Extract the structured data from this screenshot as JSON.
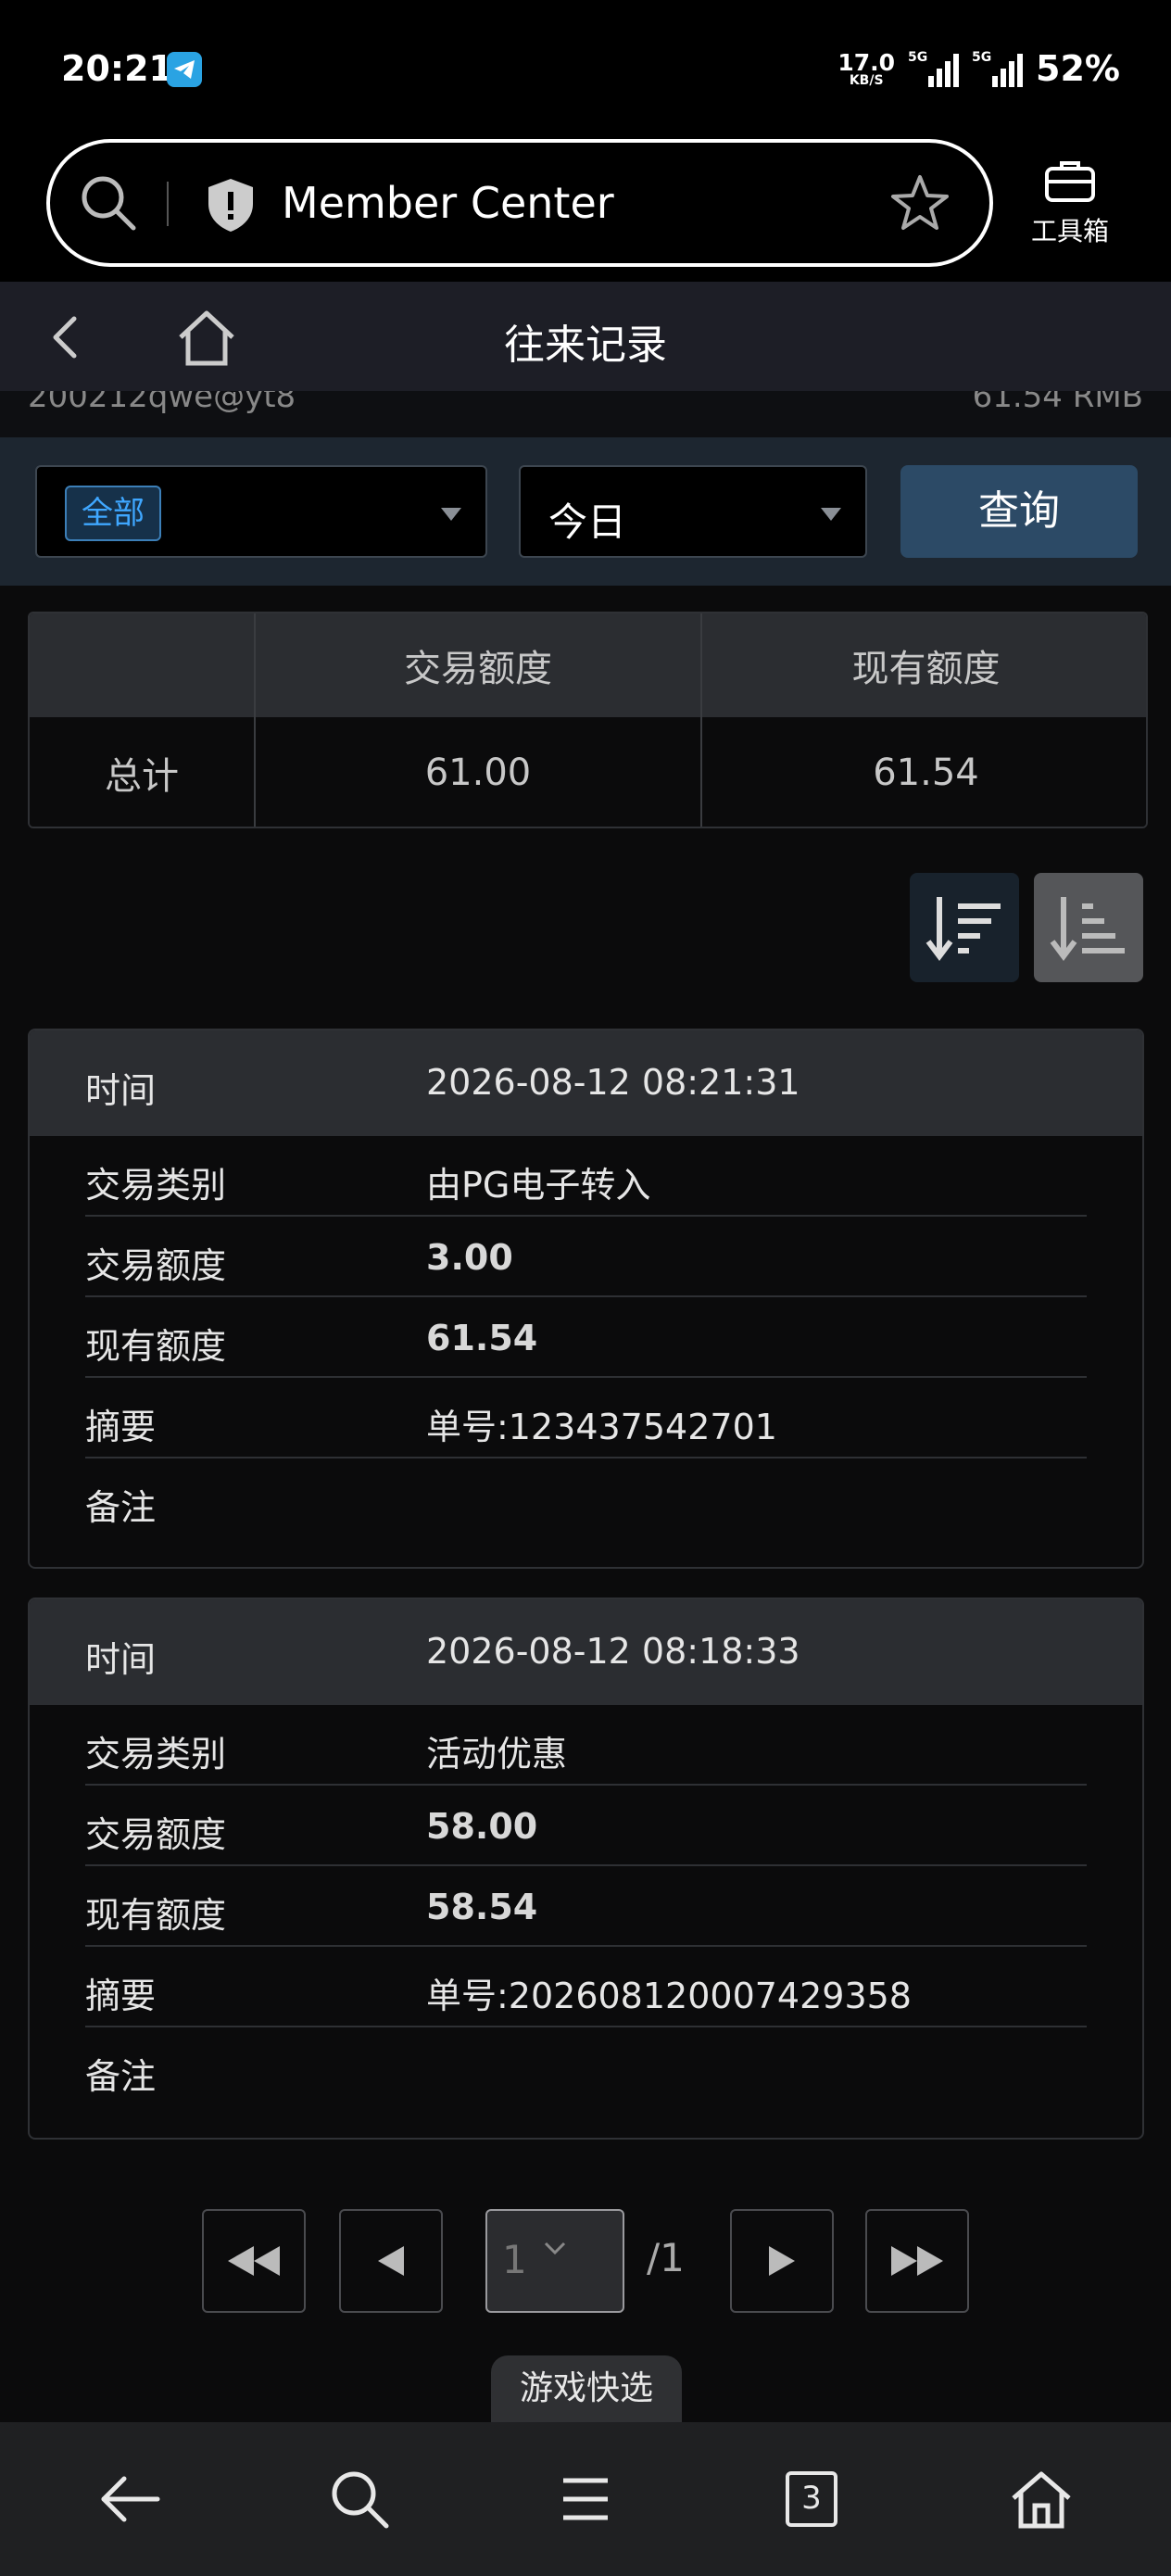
{
  "status_bar": {
    "time": "20:21",
    "net_speed_value": "17.0",
    "net_speed_unit": "KB/S",
    "signal_1_label": "5G",
    "signal_2_label": "5G",
    "battery": "52%"
  },
  "browser": {
    "address_title": "Member Center",
    "toolbox_label": "工具箱"
  },
  "header": {
    "title": "往来记录"
  },
  "account": {
    "username": "200212qwe@yt8",
    "balance": "61.54 RMB"
  },
  "filter": {
    "type_selected": "全部",
    "period_selected": "今日",
    "query_label": "查询"
  },
  "summary": {
    "headers": [
      "",
      "交易额度",
      "现有额度"
    ],
    "row_label": "总计",
    "trade_amount": "61.00",
    "current_amount": "61.54"
  },
  "records": [
    {
      "time_label": "时间",
      "time": "2026-08-12 08:21:31",
      "type_label": "交易类别",
      "type": "由PG电子转入",
      "amount_label": "交易额度",
      "amount": "3.00",
      "balance_label": "现有额度",
      "balance": "61.54",
      "summary_label": "摘要",
      "summary": "单号:123437542701",
      "note_label": "备注",
      "note": ""
    },
    {
      "time_label": "时间",
      "time": "2026-08-12 08:18:33",
      "type_label": "交易类别",
      "type": "活动优惠",
      "amount_label": "交易额度",
      "amount": "58.00",
      "balance_label": "现有额度",
      "balance": "58.54",
      "summary_label": "摘要",
      "summary": "单号:202608120007429358",
      "note_label": "备注",
      "note": ""
    }
  ],
  "pagination": {
    "current": "1",
    "total": "/1"
  },
  "quick_select": "游戏快选",
  "bottom_nav": {
    "tab_count": "3"
  },
  "colors": {
    "background": "#0b0b0c",
    "header_bg": "#1d1e26",
    "filter_bg": "#1d2630",
    "query_button": "#2c4a66",
    "chip_text": "#3fa7ff"
  },
  "icons": [
    "telegram-icon",
    "search-icon",
    "shield-icon",
    "star-icon",
    "toolbox-icon",
    "back-icon",
    "home-icon",
    "sort-desc-icon",
    "sort-asc-icon",
    "first-page-icon",
    "prev-page-icon",
    "next-page-icon",
    "last-page-icon",
    "nav-back-icon",
    "nav-search-icon",
    "nav-menu-icon",
    "nav-tabs-icon",
    "nav-home-icon"
  ]
}
